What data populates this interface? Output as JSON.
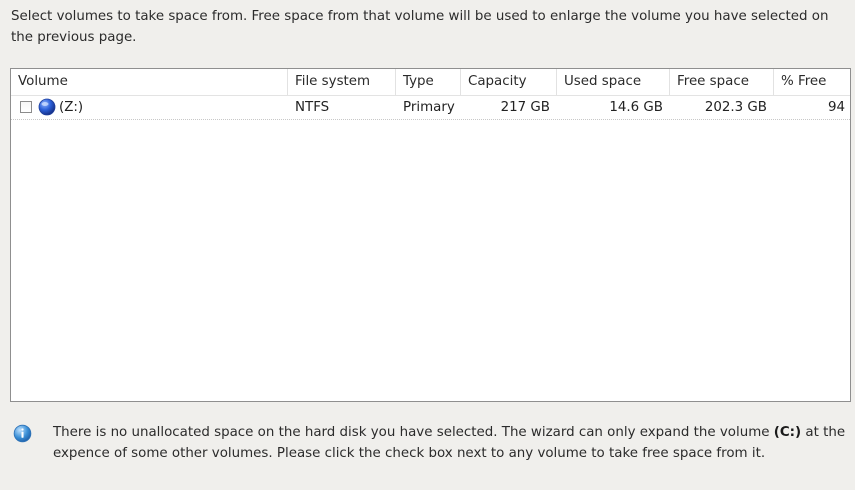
{
  "instruction": "Select volumes to take space from. Free space from that volume will be used to enlarge the volume you have selected on the previous page.",
  "table": {
    "columns": [
      "Volume",
      "File system",
      "Type",
      "Capacity",
      "Used space",
      "Free space",
      "% Free"
    ],
    "rows": [
      {
        "checked": false,
        "icon": "disk-volume-icon",
        "volume": "(Z:)",
        "file_system": "NTFS",
        "type": "Primary",
        "capacity": "217 GB",
        "used_space": "14.6 GB",
        "free_space": "202.3 GB",
        "percent_free": "94"
      }
    ]
  },
  "info": {
    "icon": "info-icon",
    "text_before": "There is no unallocated space on the hard disk you have selected. The wizard can only expand the volume ",
    "volume": "(C:)",
    "text_after": " at the expence of some other volumes. Please click the check box next to any volume to take free space from it."
  },
  "colors": {
    "background": "#f0efec",
    "list_background": "#ffffff",
    "list_border": "#8f8f8f",
    "icon_blue": "#2b5fd8",
    "info_blue": "#3a8fd6"
  }
}
